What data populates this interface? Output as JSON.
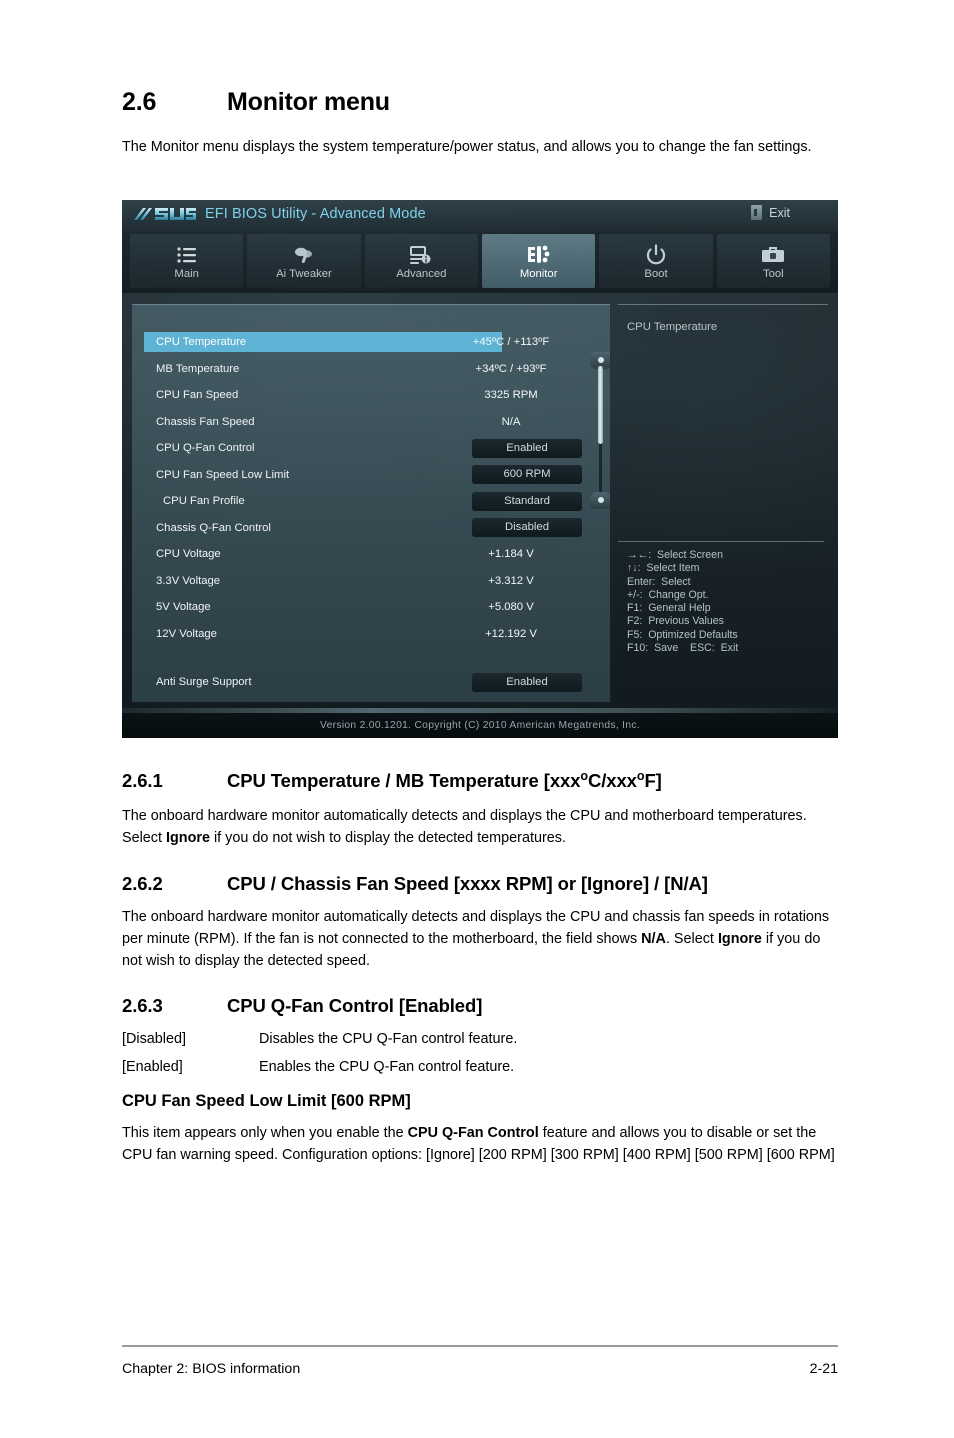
{
  "document": {
    "section": {
      "number": "2.6",
      "title": "Monitor menu",
      "intro": "The Monitor menu displays the system temperature/power status, and allows you to change the fan settings."
    },
    "subsections": [
      {
        "number": "2.6.1",
        "title_pre": "CPU Temperature / MB Temperature [xxx",
        "title_mid": "C/xxx",
        "title_post": "F]",
        "body_1": "The onboard hardware monitor automatically detects and displays the CPU and motherboard temperatures. Select ",
        "body_bold_1": "Ignore",
        "body_2": " if you do not wish to display the detected temperatures."
      },
      {
        "number": "2.6.2",
        "title": "CPU / Chassis Fan Speed [xxxx RPM] or [Ignore] / [N/A]",
        "body_1": "The onboard hardware monitor automatically detects and displays the CPU and chassis fan speeds in rotations per minute (RPM). If the fan is not connected to the motherboard, the field shows ",
        "body_bold_1": "N/A",
        "body_2": ". Select ",
        "body_bold_2": "Ignore",
        "body_3": " if you do not wish to display the detected speed."
      },
      {
        "number": "2.6.3",
        "title": "CPU Q-Fan Control [Enabled]",
        "options": [
          {
            "key": "[Disabled]",
            "desc": "Disables the CPU Q-Fan control feature."
          },
          {
            "key": "[Enabled]",
            "desc": "Enables the CPU Q-Fan control feature."
          }
        ]
      }
    ],
    "subheading": {
      "title": "CPU Fan Speed Low Limit [600 RPM]",
      "body_1": "This item appears only when you enable the ",
      "body_bold_1": "CPU Q-Fan Control",
      "body_2": " feature and allows you to disable or set the CPU fan warning speed. Configuration options: [Ignore] [200 RPM] [300 RPM] [400 RPM] [500 RPM] [600 RPM]"
    },
    "footer": {
      "left": "Chapter 2: BIOS information",
      "right": "2-21"
    }
  },
  "bios": {
    "logo_text": "ASUS",
    "title": "EFI BIOS Utility - Advanced Mode",
    "exit_label": "Exit",
    "tabs": [
      {
        "label": "Main",
        "icon": "list-icon",
        "active": false
      },
      {
        "label": "Ai  Tweaker",
        "icon": "tweaker-icon",
        "active": false
      },
      {
        "label": "Advanced",
        "icon": "advanced-icon",
        "active": false
      },
      {
        "label": "Monitor",
        "icon": "monitor-icon",
        "active": true
      },
      {
        "label": "Boot",
        "icon": "power-icon",
        "active": false
      },
      {
        "label": "Tool",
        "icon": "toolbox-icon",
        "active": false
      }
    ],
    "items": [
      {
        "label": "CPU Temperature",
        "value": "+45ºC / +113ºF",
        "type": "text",
        "selected": true,
        "indent": false,
        "gap_before": 0
      },
      {
        "label": "MB Temperature",
        "value": "+34ºC / +93ºF",
        "type": "text",
        "selected": false,
        "indent": false,
        "gap_before": 0
      },
      {
        "label": "CPU Fan Speed",
        "value": "3325 RPM",
        "type": "text",
        "selected": false,
        "indent": false,
        "gap_before": 0
      },
      {
        "label": "Chassis Fan Speed",
        "value": "N/A",
        "type": "text",
        "selected": false,
        "indent": false,
        "gap_before": 0
      },
      {
        "label": "CPU Q-Fan Control",
        "value": "Enabled",
        "type": "boxed",
        "selected": false,
        "indent": false,
        "gap_before": 0
      },
      {
        "label": "CPU Fan Speed Low Limit",
        "value": "600 RPM",
        "type": "boxed",
        "selected": false,
        "indent": false,
        "gap_before": 0
      },
      {
        "label": "CPU Fan Profile",
        "value": "Standard",
        "type": "boxed",
        "selected": false,
        "indent": true,
        "gap_before": 0
      },
      {
        "label": "Chassis Q-Fan Control",
        "value": "Disabled",
        "type": "boxed",
        "selected": false,
        "indent": false,
        "gap_before": 0
      },
      {
        "label": "CPU Voltage",
        "value": "+1.184 V",
        "type": "text",
        "selected": false,
        "indent": false,
        "gap_before": 0
      },
      {
        "label": "3.3V Voltage",
        "value": "+3.312 V",
        "type": "text",
        "selected": false,
        "indent": false,
        "gap_before": 0
      },
      {
        "label": "5V Voltage",
        "value": "+5.080 V",
        "type": "text",
        "selected": false,
        "indent": false,
        "gap_before": 0
      },
      {
        "label": "12V Voltage",
        "value": "+12.192 V",
        "type": "text",
        "selected": false,
        "indent": false,
        "gap_before": 0
      },
      {
        "label": "Anti Surge Support",
        "value": "Enabled",
        "type": "boxed",
        "selected": false,
        "indent": false,
        "gap_before": 1
      }
    ],
    "help_title": "CPU Temperature",
    "legend": [
      "→←:  Select Screen",
      "↑↓:  Select Item",
      "Enter:  Select",
      "+/-:  Change Opt.",
      "F1:  General Help",
      "F2:  Previous Values",
      "F5:  Optimized Defaults",
      "F10:  Save    ESC:  Exit"
    ],
    "version_line": "Version  2.00.1201.   Copyright  (C)  2010  American  Megatrends,  Inc.",
    "colors": {
      "accent_cyan": "#7fd2e8",
      "selection_blue": "#5fb3d4",
      "panel_bg": "#5c7882",
      "chrome_dark": "#1b282e"
    }
  }
}
